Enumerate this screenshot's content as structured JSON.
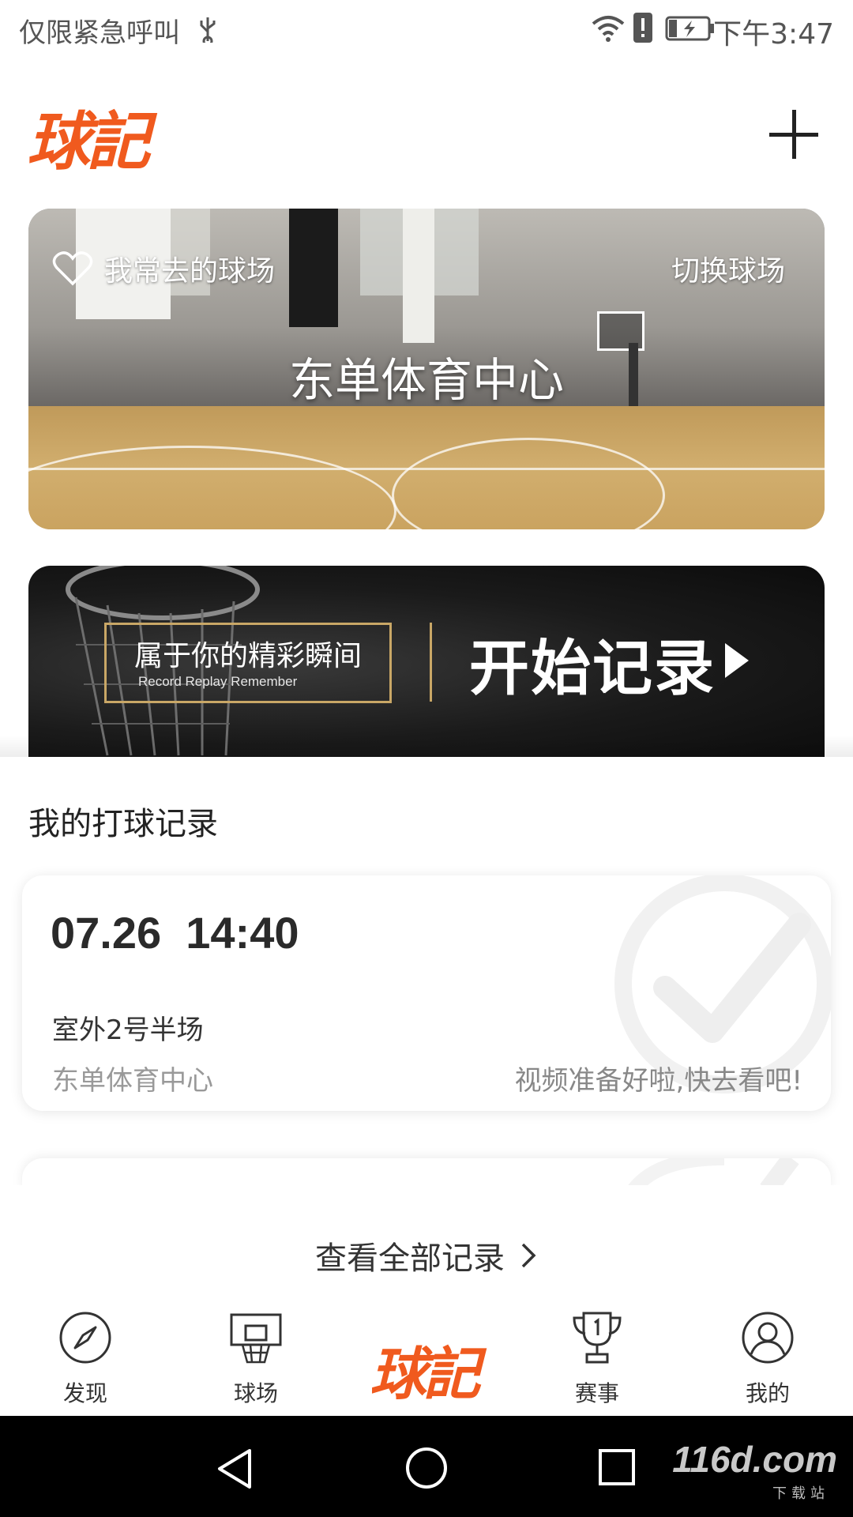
{
  "status_bar": {
    "left_text": "仅限紧急呼叫",
    "time": "下午3:47"
  },
  "header": {
    "logo": "球記",
    "add_icon": "plus-icon"
  },
  "court_card": {
    "favorite_label": "我常去的球场",
    "switch_label": "切换球场",
    "court_name": "东单体育中心"
  },
  "record_banner": {
    "tagline": "属于你的精彩瞬间",
    "tagline_sub": "Record Replay Remember",
    "cta": "开始记录"
  },
  "records_section": {
    "title": "我的打球记录",
    "items": [
      {
        "date": "07.26",
        "time": "14:40",
        "court": "室外2号半场",
        "venue": "东单体育中心",
        "status": "视频准备好啦,快去看吧!"
      }
    ],
    "view_all": "查看全部记录"
  },
  "tabs": [
    {
      "label": "发现",
      "icon": "compass-icon"
    },
    {
      "label": "球场",
      "icon": "basketball-hoop-icon"
    },
    {
      "label": "球記",
      "icon": "logo"
    },
    {
      "label": "赛事",
      "icon": "trophy-icon"
    },
    {
      "label": "我的",
      "icon": "user-icon"
    }
  ],
  "watermark": {
    "main": "116d.com",
    "sub": "下载站"
  },
  "colors": {
    "brand": "#f05a1e",
    "gold": "#c9a766"
  }
}
